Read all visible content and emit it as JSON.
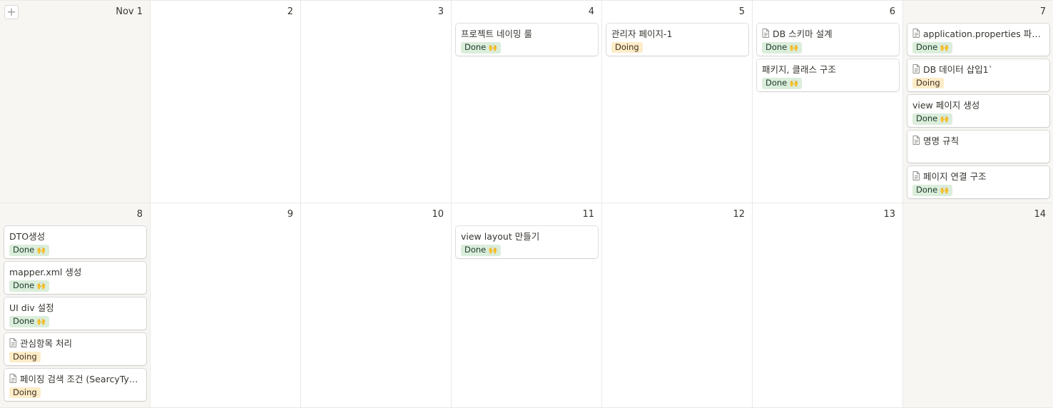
{
  "colors": {
    "done_bg": "#dbeddb",
    "doing_bg": "#fdecc8",
    "weekend_bg": "#f7f6f3",
    "border": "#e9e9e7"
  },
  "add_icon": "+",
  "doc_icon_name": "document-icon",
  "status": {
    "done": "Done",
    "doing": "Doing",
    "done_emoji": "🙌"
  },
  "days": [
    {
      "label": "Nov 1",
      "cards": []
    },
    {
      "label": "2",
      "cards": []
    },
    {
      "label": "3",
      "cards": []
    },
    {
      "label": "4",
      "cards": [
        {
          "title": "프로젝트 네이밍 룰",
          "doc": false,
          "status": "Done"
        }
      ]
    },
    {
      "label": "5",
      "cards": [
        {
          "title": "관리자 페이지-1",
          "doc": false,
          "status": "Doing"
        }
      ]
    },
    {
      "label": "6",
      "cards": [
        {
          "title": "DB 스키마 설계",
          "doc": true,
          "status": "Done"
        },
        {
          "title": "패키지, 클래스 구조",
          "doc": false,
          "status": "Done"
        }
      ]
    },
    {
      "label": "7",
      "cards": [
        {
          "title": "application.properties 파일 ...",
          "doc": true,
          "status": "Done"
        },
        {
          "title": "DB 데이터 삽입1`",
          "doc": true,
          "status": "Doing"
        },
        {
          "title": "view 페이지 생성",
          "doc": false,
          "status": "Done"
        },
        {
          "title": "명명 규칙",
          "doc": true,
          "status": ""
        },
        {
          "title": "페이지 연결 구조",
          "doc": true,
          "status": "Done"
        }
      ]
    },
    {
      "label": "8",
      "cards": [
        {
          "title": "DTO생성",
          "doc": false,
          "status": "Done"
        },
        {
          "title": "mapper.xml 생성",
          "doc": false,
          "status": "Done"
        },
        {
          "title": "UI div 설정",
          "doc": false,
          "status": "Done"
        },
        {
          "title": "관심항목 처리",
          "doc": true,
          "status": "Doing"
        },
        {
          "title": "페이징 검색 조건 (SearcyType...",
          "doc": true,
          "status": "Doing"
        }
      ]
    },
    {
      "label": "9",
      "cards": []
    },
    {
      "label": "10",
      "cards": []
    },
    {
      "label": "11",
      "cards": [
        {
          "title": "view layout 만들기",
          "doc": false,
          "status": "Done"
        }
      ]
    },
    {
      "label": "12",
      "cards": []
    },
    {
      "label": "13",
      "cards": []
    },
    {
      "label": "14",
      "cards": []
    }
  ]
}
